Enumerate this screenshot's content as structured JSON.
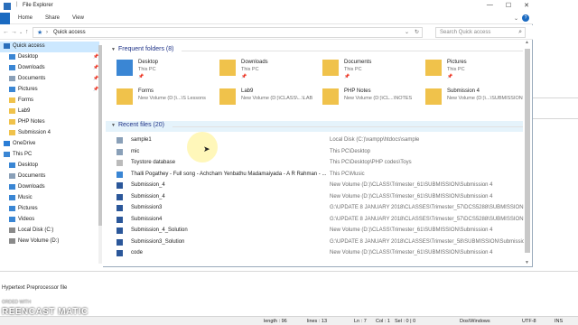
{
  "window": {
    "title": "File Explorer",
    "controls": [
      "—",
      "☐",
      "✕"
    ]
  },
  "ribbon": {
    "tabs": [
      "Home",
      "Share",
      "View"
    ]
  },
  "address": {
    "location": "Quick access",
    "search_placeholder": "Search Quick access"
  },
  "nav": {
    "items": [
      {
        "label": "Quick access",
        "icon": "star-icon",
        "color": "#2a6ebb",
        "indent": 4,
        "selected": true,
        "pinned": false
      },
      {
        "label": "Desktop",
        "icon": "desktop-icon",
        "color": "#3a86d4",
        "indent": 10,
        "pinned": true
      },
      {
        "label": "Downloads",
        "icon": "download-icon",
        "color": "#3a86d4",
        "indent": 10,
        "pinned": true
      },
      {
        "label": "Documents",
        "icon": "documents-icon",
        "color": "#8aa0b8",
        "indent": 10,
        "pinned": true
      },
      {
        "label": "Pictures",
        "icon": "pictures-icon",
        "color": "#3a86d4",
        "indent": 10,
        "pinned": true
      },
      {
        "label": "Forms",
        "icon": "folder-icon",
        "color": "#f0c24b",
        "indent": 10,
        "pinned": false
      },
      {
        "label": "Lab9",
        "icon": "folder-icon",
        "color": "#f0c24b",
        "indent": 10,
        "pinned": false
      },
      {
        "label": "PHP Notes",
        "icon": "folder-icon",
        "color": "#f0c24b",
        "indent": 10,
        "pinned": false
      },
      {
        "label": "Submission 4",
        "icon": "folder-icon",
        "color": "#f0c24b",
        "indent": 10,
        "pinned": false
      },
      {
        "label": "OneDrive",
        "icon": "cloud-icon",
        "color": "#2a7dd6",
        "indent": 4,
        "pinned": false
      },
      {
        "label": "This PC",
        "icon": "computer-icon",
        "color": "#3a86d4",
        "indent": 4,
        "pinned": false
      },
      {
        "label": "Desktop",
        "icon": "desktop-icon",
        "color": "#3a86d4",
        "indent": 10,
        "pinned": false
      },
      {
        "label": "Documents",
        "icon": "documents-icon",
        "color": "#8aa0b8",
        "indent": 10,
        "pinned": false
      },
      {
        "label": "Downloads",
        "icon": "download-icon",
        "color": "#3a86d4",
        "indent": 10,
        "pinned": false
      },
      {
        "label": "Music",
        "icon": "music-icon",
        "color": "#3a86d4",
        "indent": 10,
        "pinned": false
      },
      {
        "label": "Pictures",
        "icon": "pictures-icon",
        "color": "#3a86d4",
        "indent": 10,
        "pinned": false
      },
      {
        "label": "Videos",
        "icon": "videos-icon",
        "color": "#3a86d4",
        "indent": 10,
        "pinned": false
      },
      {
        "label": "Local Disk (C:)",
        "icon": "drive-icon",
        "color": "#8a8a8a",
        "indent": 10,
        "pinned": false
      },
      {
        "label": "New Volume (D:)",
        "icon": "drive-icon",
        "color": "#8a8a8a",
        "indent": 10,
        "pinned": false
      }
    ]
  },
  "frequent": {
    "header": "Frequent folders (8)",
    "folders": [
      {
        "name": "Desktop",
        "location": "This PC",
        "pinned": true,
        "icon": "desktop-folder-icon",
        "color": "#3a86d4"
      },
      {
        "name": "Downloads",
        "location": "This PC",
        "pinned": true,
        "icon": "downloads-folder-icon",
        "color": "#f0c24b"
      },
      {
        "name": "Documents",
        "location": "This PC",
        "pinned": true,
        "icon": "documents-folder-icon",
        "color": "#f0c24b"
      },
      {
        "name": "Pictures",
        "location": "This PC",
        "pinned": true,
        "icon": "pictures-folder-icon",
        "color": "#f0c24b"
      },
      {
        "name": "Forms",
        "location": "New Volume (D:)\\...\\S Lessons",
        "pinned": false,
        "icon": "folder-icon",
        "color": "#f0c24b"
      },
      {
        "name": "Lab9",
        "location": "New Volume (D:)\\CLASS\\...\\LAB",
        "pinned": false,
        "icon": "folder-icon",
        "color": "#f0c24b"
      },
      {
        "name": "PHP Notes",
        "location": "New Volume (D:)\\CL...\\NOTES",
        "pinned": false,
        "icon": "folder-icon",
        "color": "#f0c24b"
      },
      {
        "name": "Submission 4",
        "location": "New Volume (D:)\\...\\SUBMISSION",
        "pinned": false,
        "icon": "folder-icon",
        "color": "#f0c24b"
      }
    ]
  },
  "recent": {
    "header": "Recent files (20)",
    "files": [
      {
        "name": "sample1",
        "path": "Local Disk (C:)\\xampp\\htdocs\\sample",
        "icon": "generic-file-icon",
        "color": "#8aa0b8"
      },
      {
        "name": "mic",
        "path": "This PC\\Desktop",
        "icon": "generic-file-icon",
        "color": "#8aa0b8"
      },
      {
        "name": "Toystore database",
        "path": "This PC\\Desktop\\PHP codes\\Toys",
        "icon": "blank-file-icon",
        "color": "#bbbbbb"
      },
      {
        "name": "Thalli Pogathey - Full song - Achcham Yenbathu Madamaiyada - A R Rahman - ...",
        "path": "This PC\\Music",
        "icon": "audio-file-icon",
        "color": "#3a86d4"
      },
      {
        "name": "Submission_4",
        "path": "New Volume (D:)\\CLASS\\Trimester_61\\SUBMISSION\\Submission 4",
        "icon": "word-doc-icon",
        "color": "#2b579a"
      },
      {
        "name": "Submission_4",
        "path": "New Volume (D:)\\CLASS\\Trimester_61\\SUBMISSION\\Submission 4",
        "icon": "word-doc-icon",
        "color": "#2b579a"
      },
      {
        "name": "Submission3",
        "path": "G:\\UPDATE 8 JANUARY 2018\\CLASSES\\Trimester_57\\DCS5288\\SUBMISSION",
        "icon": "word-doc-icon",
        "color": "#2b579a"
      },
      {
        "name": "Submission4",
        "path": "G:\\UPDATE 8 JANUARY 2018\\CLASSES\\Trimester_57\\DCS5288\\SUBMISSION",
        "icon": "word-doc-icon",
        "color": "#2b579a"
      },
      {
        "name": "Submission_4_Solution",
        "path": "New Volume (D:)\\CLASS\\Trimester_61\\SUBMISSION\\Submission 4",
        "icon": "word-doc-icon",
        "color": "#2b579a"
      },
      {
        "name": "Submission3_Solution",
        "path": "G:\\UPDATE 8 JANUARY 2018\\CLASSES\\Trimester_58\\SUBMISSION\\Submission3",
        "icon": "word-doc-icon",
        "color": "#2b579a"
      },
      {
        "name": "code",
        "path": "New Volume (D:)\\CLASS\\Trimester_61\\SUBMISSION\\Submission 4",
        "icon": "word-doc-icon",
        "color": "#2b579a"
      }
    ]
  },
  "background_editor": {
    "file_type": "Hypertext Preprocessor file",
    "status": {
      "length": "length : 96",
      "lines": "lines : 13",
      "ln": "Ln : 7",
      "col": "Col : 1",
      "sel": "Sel : 0 | 0",
      "eol": "Dos\\Windows",
      "enc": "UTF-8",
      "ins": "INS"
    }
  },
  "watermark": {
    "top": "ORDED WITH",
    "bottom": "REENCAST MATIC"
  }
}
